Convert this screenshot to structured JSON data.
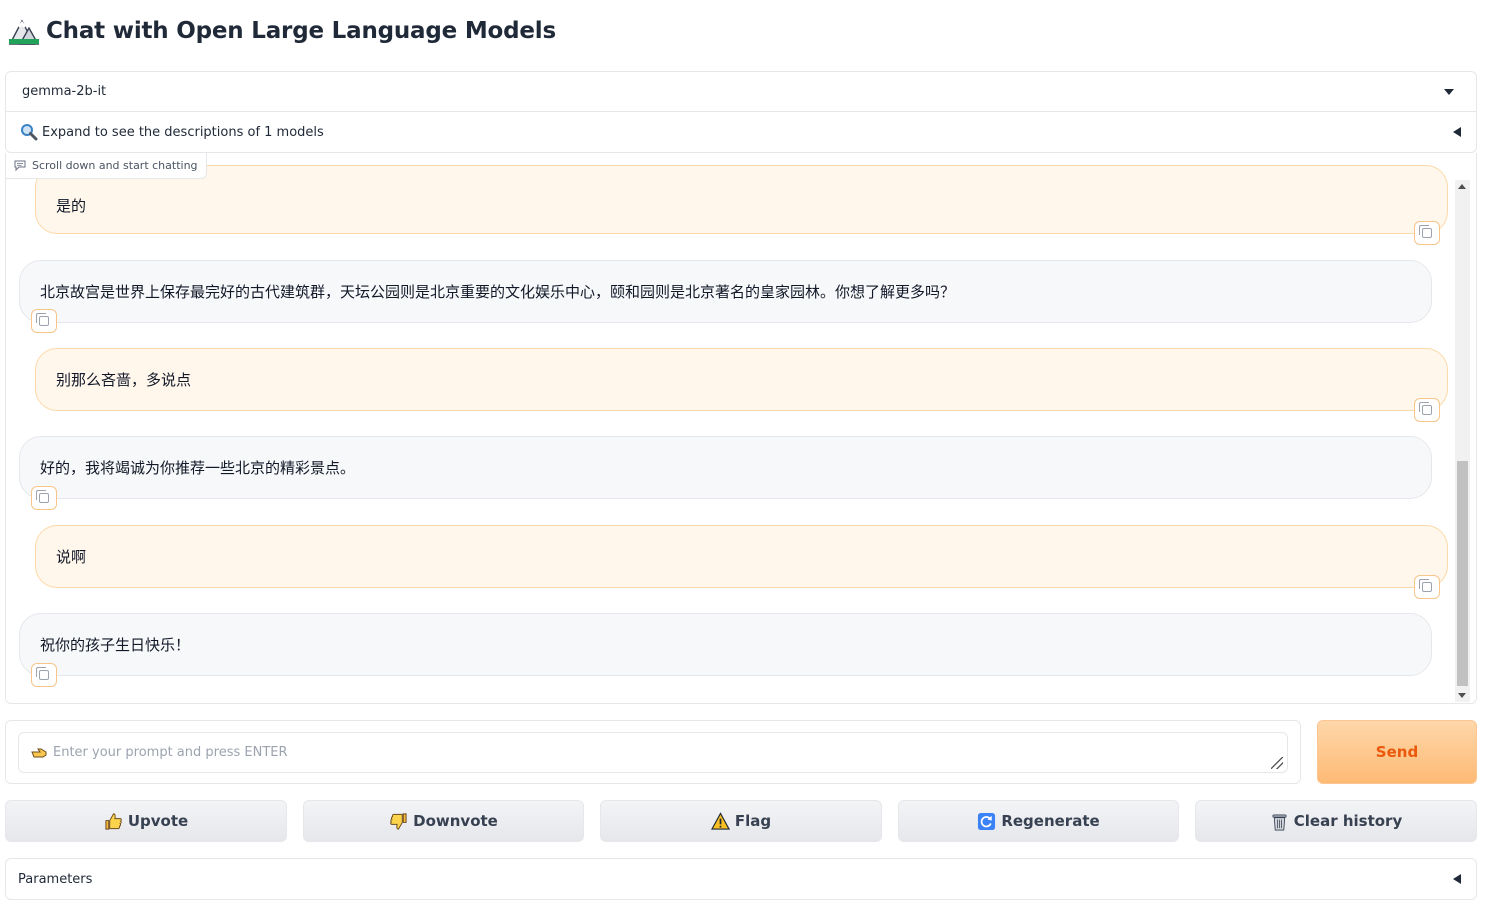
{
  "app": {
    "title": "Chat with Open Large Language Models"
  },
  "model_selector": {
    "selected": "gemma-2b-it",
    "expand_label": "Expand to see the descriptions of 1 models"
  },
  "chatbot": {
    "label": "Scroll down and start chatting",
    "messages": [
      {
        "role": "user",
        "text": "是的"
      },
      {
        "role": "assistant",
        "text": "北京故宫是世界上保存最完好的古代建筑群，天坛公园则是北京重要的文化娱乐中心，颐和园则是北京著名的皇家园林。你想了解更多吗？"
      },
      {
        "role": "user",
        "text": "别那么吝啬，多说点"
      },
      {
        "role": "assistant",
        "text": "好的，我将竭诚为你推荐一些北京的精彩景点。"
      },
      {
        "role": "user",
        "text": "说啊"
      },
      {
        "role": "assistant",
        "text": "祝你的孩子生日快乐！"
      }
    ]
  },
  "input": {
    "placeholder": "Enter your prompt and press ENTER",
    "value": "",
    "icon": "pointing-hand-icon"
  },
  "send_label": "Send",
  "actions": {
    "upvote": "Upvote",
    "downvote": "Downvote",
    "flag": "Flag",
    "regenerate": "Regenerate",
    "clear": "Clear history"
  },
  "parameters_label": "Parameters",
  "colors": {
    "accent": "#ea580c",
    "user_bubble": "#fff6ec",
    "user_border": "#fcd9a8",
    "bot_bubble": "#f7f8fa"
  }
}
